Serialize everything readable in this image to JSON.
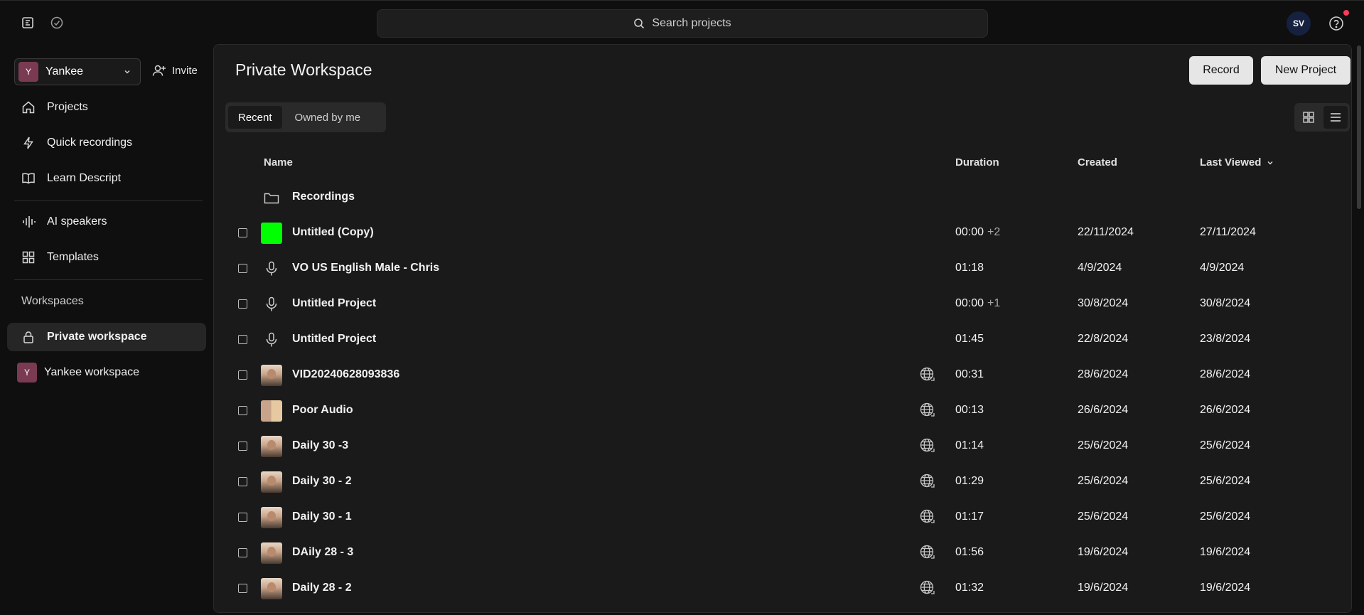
{
  "topbar": {
    "search_placeholder": "Search projects",
    "avatar_initials": "SV"
  },
  "sidebar": {
    "workspace": {
      "badge": "Y",
      "name": "Yankee"
    },
    "invite_label": "Invite",
    "nav": [
      {
        "label": "Projects",
        "icon": "home-icon"
      },
      {
        "label": "Quick recordings",
        "icon": "lightning-icon"
      },
      {
        "label": "Learn Descript",
        "icon": "book-icon"
      },
      {
        "label": "AI speakers",
        "icon": "waveform-icon"
      },
      {
        "label": "Templates",
        "icon": "grid-icon"
      }
    ],
    "workspaces_label": "Workspaces",
    "workspaces": [
      {
        "label": "Private workspace",
        "icon": "lock-icon",
        "active": true
      },
      {
        "label": "Yankee workspace",
        "badge": "Y"
      }
    ]
  },
  "main": {
    "title": "Private Workspace",
    "record_label": "Record",
    "new_project_label": "New Project",
    "tabs": [
      {
        "label": "Recent",
        "active": true
      },
      {
        "label": "Owned by me",
        "active": false
      }
    ],
    "columns": {
      "name": "Name",
      "duration": "Duration",
      "created": "Created",
      "last_viewed": "Last Viewed"
    },
    "folder": {
      "name": "Recordings"
    },
    "rows": [
      {
        "name": "Untitled (Copy)",
        "thumb": "green",
        "duration": "00:00",
        "extra": "+2",
        "created": "22/11/2024",
        "last_viewed": "27/11/2024",
        "globe": false
      },
      {
        "name": "VO US English Male - Chris",
        "thumb": "mic",
        "duration": "01:18",
        "extra": "",
        "created": "4/9/2024",
        "last_viewed": "4/9/2024",
        "globe": false
      },
      {
        "name": "Untitled Project",
        "thumb": "mic",
        "duration": "00:00",
        "extra": "+1",
        "created": "30/8/2024",
        "last_viewed": "30/8/2024",
        "globe": false
      },
      {
        "name": "Untitled Project",
        "thumb": "mic",
        "duration": "01:45",
        "extra": "",
        "created": "22/8/2024",
        "last_viewed": "23/8/2024",
        "globe": false
      },
      {
        "name": "VID20240628093836",
        "thumb": "face",
        "duration": "00:31",
        "extra": "",
        "created": "28/6/2024",
        "last_viewed": "28/6/2024",
        "globe": true
      },
      {
        "name": "Poor Audio",
        "thumb": "duo",
        "duration": "00:13",
        "extra": "",
        "created": "26/6/2024",
        "last_viewed": "26/6/2024",
        "globe": true
      },
      {
        "name": "Daily 30 -3",
        "thumb": "face",
        "duration": "01:14",
        "extra": "",
        "created": "25/6/2024",
        "last_viewed": "25/6/2024",
        "globe": true
      },
      {
        "name": "Daily 30 - 2",
        "thumb": "face",
        "duration": "01:29",
        "extra": "",
        "created": "25/6/2024",
        "last_viewed": "25/6/2024",
        "globe": true
      },
      {
        "name": "Daily 30 - 1",
        "thumb": "face",
        "duration": "01:17",
        "extra": "",
        "created": "25/6/2024",
        "last_viewed": "25/6/2024",
        "globe": true
      },
      {
        "name": "DAily 28 - 3",
        "thumb": "face",
        "duration": "01:56",
        "extra": "",
        "created": "19/6/2024",
        "last_viewed": "19/6/2024",
        "globe": true
      },
      {
        "name": "Daily 28 - 2",
        "thumb": "face",
        "duration": "01:32",
        "extra": "",
        "created": "19/6/2024",
        "last_viewed": "19/6/2024",
        "globe": true
      }
    ]
  },
  "colors": {
    "background": "#0f0f0f",
    "panel": "#1a1a1a",
    "workspace_badge": "#7a3a52",
    "avatar": "#15213f",
    "notification": "#ff3b5c",
    "thumb_green": "#00ff00"
  }
}
